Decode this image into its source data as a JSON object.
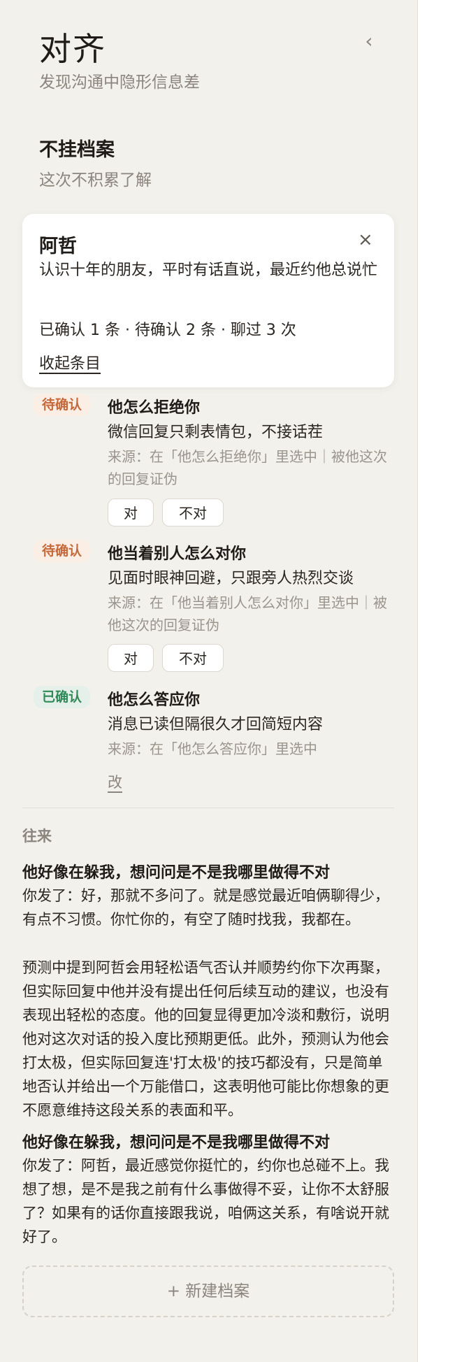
{
  "app": {
    "title": "对齐",
    "subtitle": "发现沟通中隐形信息差",
    "collapse_icon": "‹"
  },
  "section": {
    "title": "不挂档案",
    "subtitle": "这次不积累了解"
  },
  "profile": {
    "name": "阿哲",
    "close_icon": "×",
    "description": "认识十年的朋友，平时有话直说，最近约他总说忙",
    "stats": "已确认 1 条 · 待确认 2 条 · 聊过 3 次",
    "toggle_label": "收起条目"
  },
  "items": [
    {
      "status": "待确认",
      "title": "他怎么拒绝你",
      "detail": "微信回复只剩表情包，不接话茬",
      "source": "来源：在「他怎么拒绝你」里选中｜被他这次的回复证伪",
      "yes": "对",
      "no": "不对"
    },
    {
      "status": "待确认",
      "title": "他当着别人怎么对你",
      "detail": "见面时眼神回避，只跟旁人热烈交谈",
      "source": "来源：在「他当着别人怎么对你」里选中｜被他这次的回复证伪",
      "yes": "对",
      "no": "不对"
    },
    {
      "status": "已确认",
      "title": "他怎么答应你",
      "detail": "消息已读但隔很久才回简短内容",
      "source": "来源：在「他怎么答应你」里选中",
      "edit": "改"
    }
  ],
  "history": {
    "label": "往来",
    "entries": [
      {
        "title": "他好像在躲我，想问问是不是我哪里做得不对",
        "message": "你发了：好，那就不多问了。就是感觉最近咱俩聊得少，有点不习惯。你忙你的，有空了随时找我，我都在。",
        "analysis": "预测中提到阿哲会用轻松语气否认并顺势约你下次再聚，但实际回复中他并没有提出任何后续互动的建议，也没有表现出轻松的态度。他的回复显得更加冷淡和敷衍，说明他对这次对话的投入度比预期更低。此外，预测认为他会打太极，但实际回复连'打太极'的技巧都没有，只是简单地否认并给出一个万能借口，这表明他可能比你想象的更不愿意维持这段关系的表面和平。"
      },
      {
        "title": "他好像在躲我，想问问是不是我哪里做得不对",
        "message": "你发了：阿哲，最近感觉你挺忙的，约你也总碰不上。我想了想，是不是我之前有什么事做得不妥，让你不太舒服了？如果有的话你直接跟我说，咱俩这关系，有啥说开就好了。"
      }
    ]
  },
  "new_profile_label": "+ 新建档案",
  "colors": {
    "panel_bg": "#f3f1ec",
    "pending": "#c5693a",
    "confirmed": "#2f8a58"
  }
}
